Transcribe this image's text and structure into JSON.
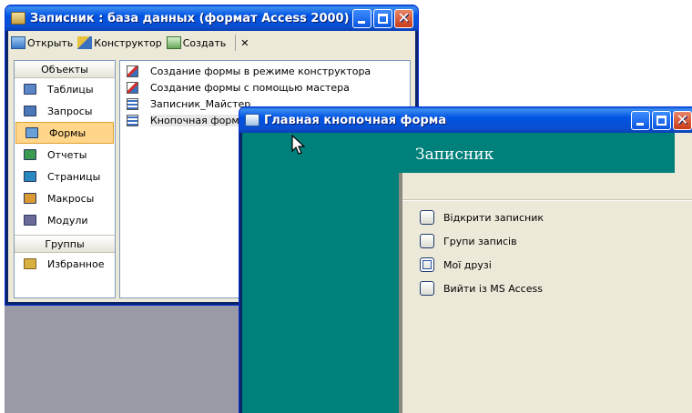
{
  "db_window": {
    "title": "Записник : база данных (формат Access 2000)",
    "toolbar": {
      "open": "Открыть",
      "constructor": "Конструктор",
      "create": "Создать"
    },
    "objects_header": "Объекты",
    "objects": [
      {
        "label": "Таблицы",
        "icon": "table-icon",
        "color": "#5a86c8"
      },
      {
        "label": "Запросы",
        "icon": "query-icon",
        "color": "#4a78b8"
      },
      {
        "label": "Формы",
        "icon": "form-icon",
        "color": "#6aa0d8",
        "selected": true
      },
      {
        "label": "Отчеты",
        "icon": "report-icon",
        "color": "#3a9a50"
      },
      {
        "label": "Страницы",
        "icon": "page-icon",
        "color": "#2a8ac0"
      },
      {
        "label": "Макросы",
        "icon": "macro-icon",
        "color": "#d89a30"
      },
      {
        "label": "Модули",
        "icon": "module-icon",
        "color": "#6a6a9a"
      }
    ],
    "groups_header": "Группы",
    "groups": [
      {
        "label": "Избранное",
        "icon": "favorites-folder-icon",
        "color": "#d8b040"
      }
    ],
    "forms": [
      {
        "label": "Создание формы в режиме конструктора",
        "icon": "wizard-icon"
      },
      {
        "label": "Создание формы с помощью мастера",
        "icon": "wizard-icon"
      },
      {
        "label": "Записник_Майстер",
        "icon": "form-icon"
      },
      {
        "label": "Кнопочная форма",
        "icon": "form-icon",
        "selected": true
      }
    ]
  },
  "switchboard": {
    "window_title": "Главная кнопочная форма",
    "heading": "Записник",
    "items": [
      {
        "label": "Відкрити записник"
      },
      {
        "label": "Групи записів"
      },
      {
        "label": "Мої друзі",
        "focused": true
      },
      {
        "label": "Вийти із MS Access"
      }
    ]
  },
  "colors": {
    "teal": "#00807a",
    "xp_title_blue": "#0054e3",
    "window_face": "#ece9d8",
    "selection": "#ffd68a"
  }
}
